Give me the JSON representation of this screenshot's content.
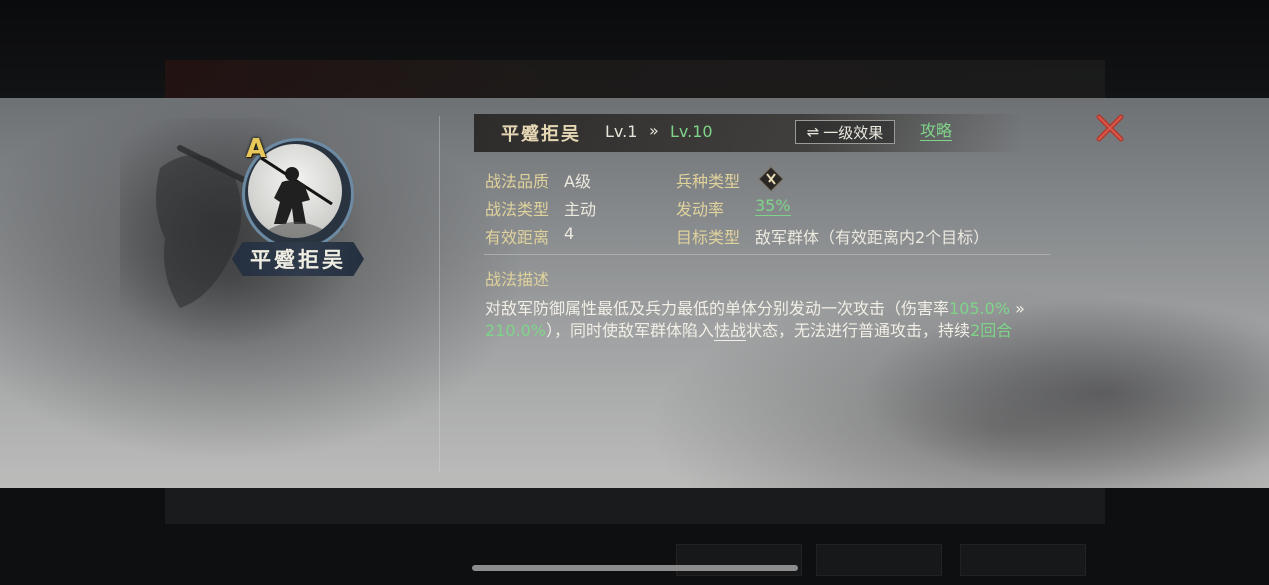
{
  "skill": {
    "name": "平蹙拒吴",
    "grade_letter": "A",
    "level_current": "Lv.1",
    "level_arrow": "»",
    "level_max": "Lv.10",
    "effect_button_label": "一级效果",
    "effect_button_icon": "⇌",
    "guide_label": "攻略"
  },
  "attributes": {
    "quality_label": "战法品质",
    "quality_value": "A级",
    "troop_label": "兵种类型",
    "troop_icon": "troop-type-icon",
    "type_label": "战法类型",
    "type_value": "主动",
    "rate_label": "发动率",
    "rate_value": "35%",
    "range_label": "有效距离",
    "range_value": "4",
    "target_label": "目标类型",
    "target_value": "敌军群体（有效距离内2个目标）"
  },
  "description": {
    "heading": "战法描述",
    "part1": "对敌军防御属性最低及兵力最低的单体分别发动一次攻击（伤害率",
    "dmg_min": "105.0%",
    "arrow": "»",
    "dmg_max": "210.0%",
    "part2": "），同时使敌军群体陷入",
    "status": "怯战",
    "part3": "状态，无法进行普通攻击，持续",
    "duration": "2回合"
  },
  "colors": {
    "accent_green": "#7fd48a",
    "label_gold": "#e0d29c",
    "close_red": "#c0392b"
  }
}
